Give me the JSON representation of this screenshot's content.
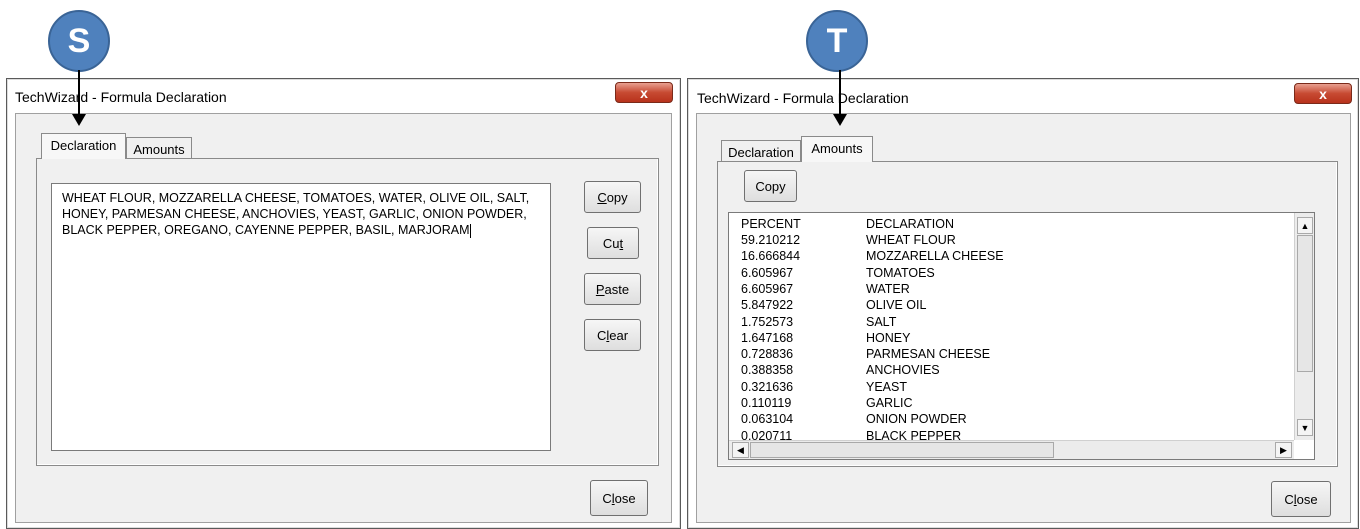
{
  "markers": {
    "left": "S",
    "right": "T"
  },
  "colors": {
    "marker": "#4f81bd",
    "close_button": "#c74a32"
  },
  "left_window": {
    "title": "TechWizard - Formula Declaration",
    "close_glyph": "x",
    "tabs": [
      "Declaration",
      "Amounts"
    ],
    "active_tab": "Declaration",
    "declaration_text": "WHEAT FLOUR, MOZZARELLA CHEESE, TOMATOES, WATER, OLIVE OIL, SALT,\nHONEY, PARMESAN CHEESE, ANCHOVIES, YEAST, GARLIC, ONION POWDER,\nBLACK PEPPER, OREGANO, CAYENNE PEPPER, BASIL, MARJORAM",
    "buttons": {
      "copy": {
        "before": "",
        "key": "C",
        "after": "opy"
      },
      "cut": {
        "before": "Cu",
        "key": "t",
        "after": ""
      },
      "paste": {
        "before": "",
        "key": "P",
        "after": "aste"
      },
      "clear": {
        "before": "C",
        "key": "l",
        "after": "ear"
      }
    },
    "close_button": {
      "before": "C",
      "key": "l",
      "after": "ose"
    }
  },
  "right_window": {
    "title": "TechWizard - Formula Declaration",
    "close_glyph": "x",
    "tabs": [
      "Declaration",
      "Amounts"
    ],
    "active_tab": "Amounts",
    "copy_button": "Copy",
    "list_headers": {
      "percent": "PERCENT",
      "declaration": "DECLARATION"
    },
    "rows": [
      {
        "percent": "59.210212",
        "declaration": "WHEAT FLOUR"
      },
      {
        "percent": "16.666844",
        "declaration": "MOZZARELLA CHEESE"
      },
      {
        "percent": "6.605967",
        "declaration": "TOMATOES"
      },
      {
        "percent": "6.605967",
        "declaration": "WATER"
      },
      {
        "percent": "5.847922",
        "declaration": "OLIVE OIL"
      },
      {
        "percent": "1.752573",
        "declaration": "SALT"
      },
      {
        "percent": "1.647168",
        "declaration": "HONEY"
      },
      {
        "percent": "0.728836",
        "declaration": "PARMESAN CHEESE"
      },
      {
        "percent": "0.388358",
        "declaration": "ANCHOVIES"
      },
      {
        "percent": "0.321636",
        "declaration": "YEAST"
      },
      {
        "percent": "0.110119",
        "declaration": "GARLIC"
      },
      {
        "percent": "0.063104",
        "declaration": "ONION POWDER"
      },
      {
        "percent": "0.020711",
        "declaration": "BLACK PEPPER"
      }
    ],
    "close_button": {
      "before": "C",
      "key": "l",
      "after": "ose"
    }
  }
}
